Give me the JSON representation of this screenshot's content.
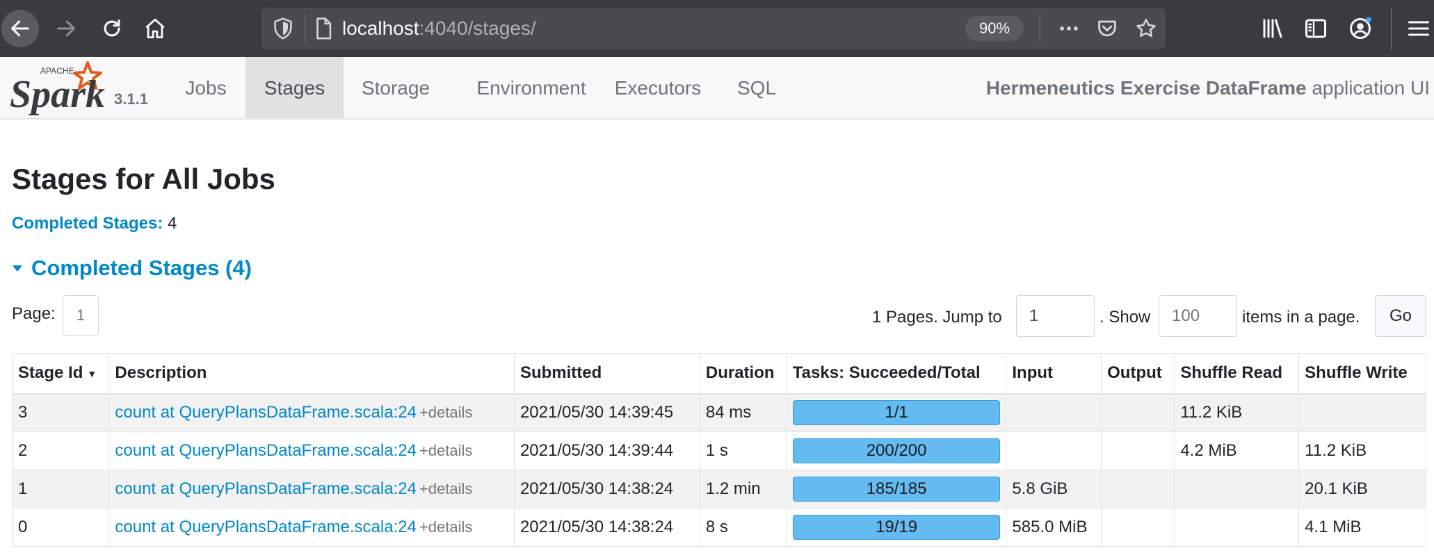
{
  "browser": {
    "url_host": "localhost",
    "url_rest": ":4040/stages/",
    "zoom": "90%",
    "accent": "#3a3a3f"
  },
  "navbar": {
    "logo_top": "APACHE",
    "logo_word": "Spark",
    "version": "3.1.1",
    "tabs": [
      {
        "label": "Jobs"
      },
      {
        "label": "Stages"
      },
      {
        "label": "Storage"
      },
      {
        "label": "Environment"
      },
      {
        "label": "Executors"
      },
      {
        "label": "SQL"
      }
    ],
    "active_tab": "Stages",
    "app_name": "Hermeneutics Exercise DataFrame",
    "app_suffix": " application UI"
  },
  "page": {
    "title": "Stages for All Jobs",
    "summary_label": "Completed Stages:",
    "summary_count": "4",
    "section_title": "Completed Stages (4)"
  },
  "pagination": {
    "page_label": "Page:",
    "page_value": "1",
    "jump_label": "1 Pages. Jump to",
    "jump_value": "1",
    "show_label": ". Show",
    "show_value": "100",
    "items_label": "items in a page.",
    "go_label": "Go"
  },
  "table": {
    "headers": [
      "Stage Id",
      "Description",
      "Submitted",
      "Duration",
      "Tasks: Succeeded/Total",
      "Input",
      "Output",
      "Shuffle Read",
      "Shuffle Write"
    ],
    "sort_indicator": "▼",
    "details_label": "+details",
    "rows": [
      {
        "id": "3",
        "description": "count at QueryPlansDataFrame.scala:24",
        "submitted": "2021/05/30 14:39:45",
        "duration": "84 ms",
        "tasks": "1/1",
        "tasks_fraction": 1.0,
        "input": "",
        "output": "",
        "shuffle_read": "11.2 KiB",
        "shuffle_write": ""
      },
      {
        "id": "2",
        "description": "count at QueryPlansDataFrame.scala:24",
        "submitted": "2021/05/30 14:39:44",
        "duration": "1 s",
        "tasks": "200/200",
        "tasks_fraction": 1.0,
        "input": "",
        "output": "",
        "shuffle_read": "4.2 MiB",
        "shuffle_write": "11.2 KiB"
      },
      {
        "id": "1",
        "description": "count at QueryPlansDataFrame.scala:24",
        "submitted": "2021/05/30 14:38:24",
        "duration": "1.2 min",
        "tasks": "185/185",
        "tasks_fraction": 1.0,
        "input": "5.8 GiB",
        "output": "",
        "shuffle_read": "",
        "shuffle_write": "20.1 KiB"
      },
      {
        "id": "0",
        "description": "count at QueryPlansDataFrame.scala:24",
        "submitted": "2021/05/30 14:38:24",
        "duration": "8 s",
        "tasks": "19/19",
        "tasks_fraction": 1.0,
        "input": "585.0 MiB",
        "output": "",
        "shuffle_read": "",
        "shuffle_write": "4.1 MiB"
      }
    ]
  },
  "colors": {
    "link": "#0088cc",
    "progress": "#5cb8f0",
    "navbar_bg": "#f8f8f8",
    "active_tab_bg": "#e1e1e1"
  }
}
